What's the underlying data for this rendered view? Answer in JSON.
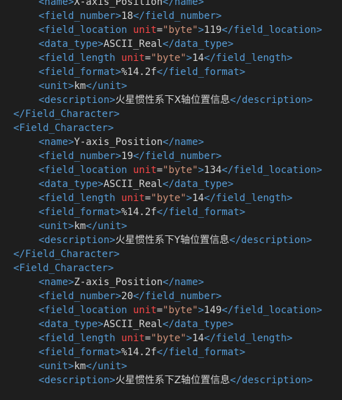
{
  "colors": {
    "background": "#1e1e1e",
    "tag": "#569cd6",
    "text": "#d4d4d4",
    "attribute": "#f44747",
    "string": "#ce9178"
  },
  "lines": [
    {
      "indent": 2,
      "tokens": [
        {
          "t": "tag",
          "v": "<name>"
        },
        {
          "t": "text",
          "v": "X-axis_Position"
        },
        {
          "t": "tag",
          "v": "</name>"
        }
      ]
    },
    {
      "indent": 2,
      "tokens": [
        {
          "t": "tag",
          "v": "<field_number>"
        },
        {
          "t": "text",
          "v": "18"
        },
        {
          "t": "tag",
          "v": "</field_number>"
        }
      ]
    },
    {
      "indent": 2,
      "tokens": [
        {
          "t": "tag",
          "v": "<field_location "
        },
        {
          "t": "attr",
          "v": "unit"
        },
        {
          "t": "punct",
          "v": "="
        },
        {
          "t": "str",
          "v": "\"byte\""
        },
        {
          "t": "tag",
          "v": ">"
        },
        {
          "t": "text",
          "v": "119"
        },
        {
          "t": "tag",
          "v": "</field_location>"
        }
      ]
    },
    {
      "indent": 2,
      "tokens": [
        {
          "t": "tag",
          "v": "<data_type>"
        },
        {
          "t": "text",
          "v": "ASCII_Real"
        },
        {
          "t": "tag",
          "v": "</data_type>"
        }
      ]
    },
    {
      "indent": 2,
      "tokens": [
        {
          "t": "tag",
          "v": "<field_length "
        },
        {
          "t": "attr",
          "v": "unit"
        },
        {
          "t": "punct",
          "v": "="
        },
        {
          "t": "str",
          "v": "\"byte\""
        },
        {
          "t": "tag",
          "v": ">"
        },
        {
          "t": "text",
          "v": "14"
        },
        {
          "t": "tag",
          "v": "</field_length>"
        }
      ]
    },
    {
      "indent": 2,
      "tokens": [
        {
          "t": "tag",
          "v": "<field_format>"
        },
        {
          "t": "text",
          "v": "%14.2f"
        },
        {
          "t": "tag",
          "v": "</field_format>"
        }
      ]
    },
    {
      "indent": 2,
      "tokens": [
        {
          "t": "tag",
          "v": "<unit>"
        },
        {
          "t": "text",
          "v": "km"
        },
        {
          "t": "tag",
          "v": "</unit>"
        }
      ]
    },
    {
      "indent": 2,
      "tokens": [
        {
          "t": "tag",
          "v": "<description>"
        },
        {
          "t": "cjk",
          "v": "火星惯性系下X轴位置信息"
        },
        {
          "t": "tag",
          "v": "</description>"
        }
      ]
    },
    {
      "indent": 1,
      "tokens": [
        {
          "t": "tag",
          "v": "</Field_Character>"
        }
      ]
    },
    {
      "indent": 1,
      "tokens": [
        {
          "t": "tag",
          "v": "<Field_Character>"
        }
      ]
    },
    {
      "indent": 2,
      "tokens": [
        {
          "t": "tag",
          "v": "<name>"
        },
        {
          "t": "text",
          "v": "Y-axis_Position"
        },
        {
          "t": "tag",
          "v": "</name>"
        }
      ]
    },
    {
      "indent": 2,
      "tokens": [
        {
          "t": "tag",
          "v": "<field_number>"
        },
        {
          "t": "text",
          "v": "19"
        },
        {
          "t": "tag",
          "v": "</field_number>"
        }
      ]
    },
    {
      "indent": 2,
      "tokens": [
        {
          "t": "tag",
          "v": "<field_location "
        },
        {
          "t": "attr",
          "v": "unit"
        },
        {
          "t": "punct",
          "v": "="
        },
        {
          "t": "str",
          "v": "\"byte\""
        },
        {
          "t": "tag",
          "v": ">"
        },
        {
          "t": "text",
          "v": "134"
        },
        {
          "t": "tag",
          "v": "</field_location>"
        }
      ]
    },
    {
      "indent": 2,
      "tokens": [
        {
          "t": "tag",
          "v": "<data_type>"
        },
        {
          "t": "text",
          "v": "ASCII_Real"
        },
        {
          "t": "tag",
          "v": "</data_type>"
        }
      ]
    },
    {
      "indent": 2,
      "tokens": [
        {
          "t": "tag",
          "v": "<field_length "
        },
        {
          "t": "attr",
          "v": "unit"
        },
        {
          "t": "punct",
          "v": "="
        },
        {
          "t": "str",
          "v": "\"byte\""
        },
        {
          "t": "tag",
          "v": ">"
        },
        {
          "t": "text",
          "v": "14"
        },
        {
          "t": "tag",
          "v": "</field_length>"
        }
      ]
    },
    {
      "indent": 2,
      "tokens": [
        {
          "t": "tag",
          "v": "<field_format>"
        },
        {
          "t": "text",
          "v": "%14.2f"
        },
        {
          "t": "tag",
          "v": "</field_format>"
        }
      ]
    },
    {
      "indent": 2,
      "tokens": [
        {
          "t": "tag",
          "v": "<unit>"
        },
        {
          "t": "text",
          "v": "km"
        },
        {
          "t": "tag",
          "v": "</unit>"
        }
      ]
    },
    {
      "indent": 2,
      "tokens": [
        {
          "t": "tag",
          "v": "<description>"
        },
        {
          "t": "cjk",
          "v": "火星惯性系下Y轴位置信息"
        },
        {
          "t": "tag",
          "v": "</description>"
        }
      ]
    },
    {
      "indent": 1,
      "tokens": [
        {
          "t": "tag",
          "v": "</Field_Character>"
        }
      ]
    },
    {
      "indent": 1,
      "tokens": [
        {
          "t": "tag",
          "v": "<Field_Character>"
        }
      ]
    },
    {
      "indent": 2,
      "tokens": [
        {
          "t": "tag",
          "v": "<name>"
        },
        {
          "t": "text",
          "v": "Z-axis_Position"
        },
        {
          "t": "tag",
          "v": "</name>"
        }
      ]
    },
    {
      "indent": 2,
      "tokens": [
        {
          "t": "tag",
          "v": "<field_number>"
        },
        {
          "t": "text",
          "v": "20"
        },
        {
          "t": "tag",
          "v": "</field_number>"
        }
      ]
    },
    {
      "indent": 2,
      "tokens": [
        {
          "t": "tag",
          "v": "<field_location "
        },
        {
          "t": "attr",
          "v": "unit"
        },
        {
          "t": "punct",
          "v": "="
        },
        {
          "t": "str",
          "v": "\"byte\""
        },
        {
          "t": "tag",
          "v": ">"
        },
        {
          "t": "text",
          "v": "149"
        },
        {
          "t": "tag",
          "v": "</field_location>"
        }
      ]
    },
    {
      "indent": 2,
      "tokens": [
        {
          "t": "tag",
          "v": "<data_type>"
        },
        {
          "t": "text",
          "v": "ASCII_Real"
        },
        {
          "t": "tag",
          "v": "</data_type>"
        }
      ]
    },
    {
      "indent": 2,
      "tokens": [
        {
          "t": "tag",
          "v": "<field_length "
        },
        {
          "t": "attr",
          "v": "unit"
        },
        {
          "t": "punct",
          "v": "="
        },
        {
          "t": "str",
          "v": "\"byte\""
        },
        {
          "t": "tag",
          "v": ">"
        },
        {
          "t": "text",
          "v": "14"
        },
        {
          "t": "tag",
          "v": "</field_length>"
        }
      ]
    },
    {
      "indent": 2,
      "tokens": [
        {
          "t": "tag",
          "v": "<field_format>"
        },
        {
          "t": "text",
          "v": "%14.2f"
        },
        {
          "t": "tag",
          "v": "</field_format>"
        }
      ]
    },
    {
      "indent": 2,
      "tokens": [
        {
          "t": "tag",
          "v": "<unit>"
        },
        {
          "t": "text",
          "v": "km"
        },
        {
          "t": "tag",
          "v": "</unit>"
        }
      ]
    },
    {
      "indent": 2,
      "tokens": [
        {
          "t": "tag",
          "v": "<description>"
        },
        {
          "t": "cjk",
          "v": "火星惯性系下Z轴位置信息"
        },
        {
          "t": "tag",
          "v": "</description>"
        }
      ]
    }
  ]
}
